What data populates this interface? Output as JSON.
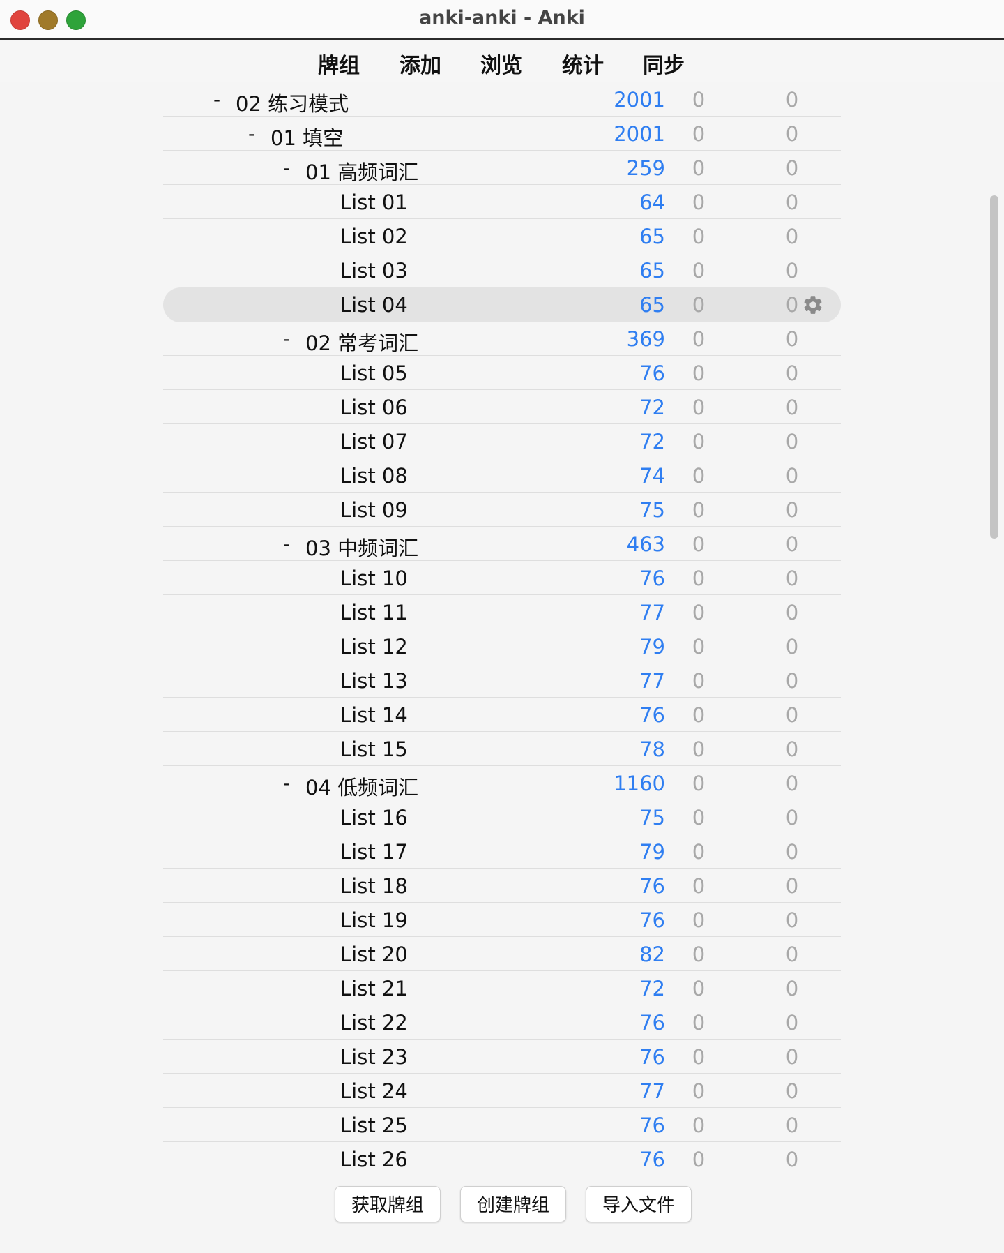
{
  "window": {
    "title": "anki-anki - Anki"
  },
  "toolbar": {
    "tabs": [
      "牌组",
      "添加",
      "浏览",
      "统计",
      "同步"
    ]
  },
  "decks": [
    {
      "level": 0,
      "collapse": "-",
      "name": "02 练习模式",
      "new": "2001",
      "learn": "0",
      "due": "0"
    },
    {
      "level": 1,
      "collapse": "-",
      "name": "01 填空",
      "new": "2001",
      "learn": "0",
      "due": "0"
    },
    {
      "level": 2,
      "collapse": "-",
      "name": "01 高频词汇",
      "new": "259",
      "learn": "0",
      "due": "0"
    },
    {
      "level": 3,
      "collapse": "",
      "name": "List 01",
      "new": "64",
      "learn": "0",
      "due": "0"
    },
    {
      "level": 3,
      "collapse": "",
      "name": "List 02",
      "new": "65",
      "learn": "0",
      "due": "0"
    },
    {
      "level": 3,
      "collapse": "",
      "name": "List 03",
      "new": "65",
      "learn": "0",
      "due": "0"
    },
    {
      "level": 3,
      "collapse": "",
      "name": "List 04",
      "new": "65",
      "learn": "0",
      "due": "0",
      "selected": true
    },
    {
      "level": 2,
      "collapse": "-",
      "name": "02 常考词汇",
      "new": "369",
      "learn": "0",
      "due": "0"
    },
    {
      "level": 3,
      "collapse": "",
      "name": "List 05",
      "new": "76",
      "learn": "0",
      "due": "0"
    },
    {
      "level": 3,
      "collapse": "",
      "name": "List 06",
      "new": "72",
      "learn": "0",
      "due": "0"
    },
    {
      "level": 3,
      "collapse": "",
      "name": "List 07",
      "new": "72",
      "learn": "0",
      "due": "0"
    },
    {
      "level": 3,
      "collapse": "",
      "name": "List 08",
      "new": "74",
      "learn": "0",
      "due": "0"
    },
    {
      "level": 3,
      "collapse": "",
      "name": "List 09",
      "new": "75",
      "learn": "0",
      "due": "0"
    },
    {
      "level": 2,
      "collapse": "-",
      "name": "03 中频词汇",
      "new": "463",
      "learn": "0",
      "due": "0"
    },
    {
      "level": 3,
      "collapse": "",
      "name": "List 10",
      "new": "76",
      "learn": "0",
      "due": "0"
    },
    {
      "level": 3,
      "collapse": "",
      "name": "List 11",
      "new": "77",
      "learn": "0",
      "due": "0"
    },
    {
      "level": 3,
      "collapse": "",
      "name": "List 12",
      "new": "79",
      "learn": "0",
      "due": "0"
    },
    {
      "level": 3,
      "collapse": "",
      "name": "List 13",
      "new": "77",
      "learn": "0",
      "due": "0"
    },
    {
      "level": 3,
      "collapse": "",
      "name": "List 14",
      "new": "76",
      "learn": "0",
      "due": "0"
    },
    {
      "level": 3,
      "collapse": "",
      "name": "List 15",
      "new": "78",
      "learn": "0",
      "due": "0"
    },
    {
      "level": 2,
      "collapse": "-",
      "name": "04 低频词汇",
      "new": "1160",
      "learn": "0",
      "due": "0"
    },
    {
      "level": 3,
      "collapse": "",
      "name": "List 16",
      "new": "75",
      "learn": "0",
      "due": "0"
    },
    {
      "level": 3,
      "collapse": "",
      "name": "List 17",
      "new": "79",
      "learn": "0",
      "due": "0"
    },
    {
      "level": 3,
      "collapse": "",
      "name": "List 18",
      "new": "76",
      "learn": "0",
      "due": "0"
    },
    {
      "level": 3,
      "collapse": "",
      "name": "List 19",
      "new": "76",
      "learn": "0",
      "due": "0"
    },
    {
      "level": 3,
      "collapse": "",
      "name": "List 20",
      "new": "82",
      "learn": "0",
      "due": "0"
    },
    {
      "level": 3,
      "collapse": "",
      "name": "List 21",
      "new": "72",
      "learn": "0",
      "due": "0"
    },
    {
      "level": 3,
      "collapse": "",
      "name": "List 22",
      "new": "76",
      "learn": "0",
      "due": "0"
    },
    {
      "level": 3,
      "collapse": "",
      "name": "List 23",
      "new": "76",
      "learn": "0",
      "due": "0"
    },
    {
      "level": 3,
      "collapse": "",
      "name": "List 24",
      "new": "77",
      "learn": "0",
      "due": "0"
    },
    {
      "level": 3,
      "collapse": "",
      "name": "List 25",
      "new": "76",
      "learn": "0",
      "due": "0"
    },
    {
      "level": 3,
      "collapse": "",
      "name": "List 26",
      "new": "76",
      "learn": "0",
      "due": "0"
    }
  ],
  "icons": {
    "row_options": "gear-icon"
  },
  "colors": {
    "new_count": "#2f7ef1",
    "zero_count": "#a8a8a8",
    "selected_row": "#e3e3e3"
  },
  "footer": {
    "get_shared": "获取牌组",
    "create_deck": "创建牌组",
    "import_file": "导入文件"
  }
}
